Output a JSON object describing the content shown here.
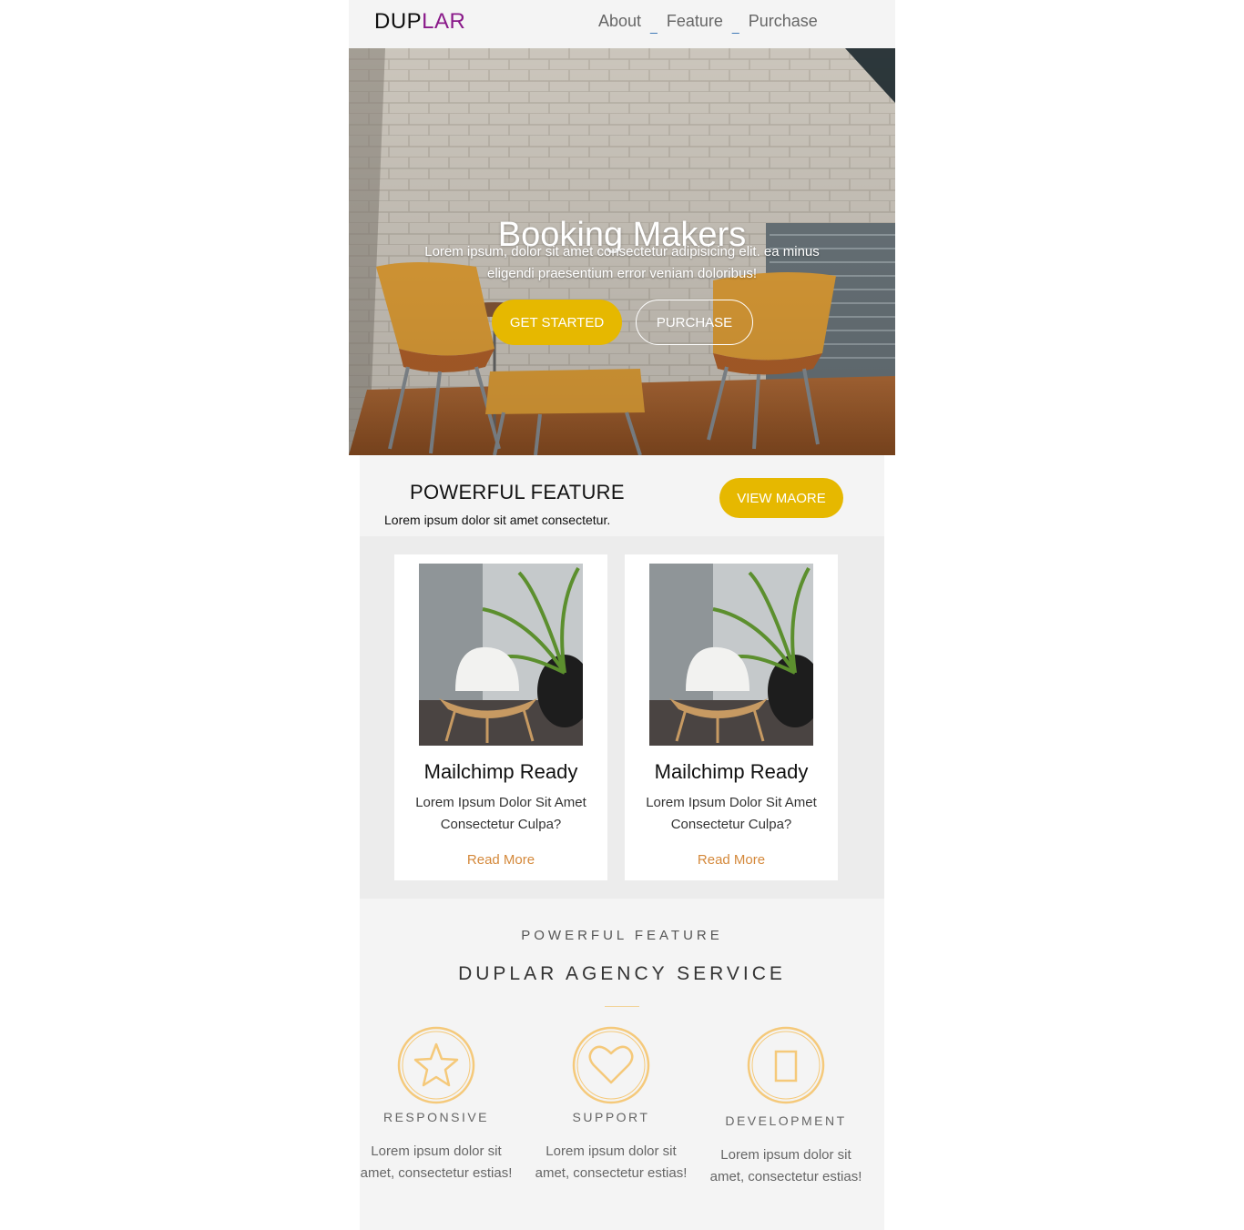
{
  "header": {
    "logo_part1": "DUP",
    "logo_part2": "LAR",
    "nav": [
      "About",
      "Feature",
      "Purchase"
    ]
  },
  "hero": {
    "title": "Booking Makers",
    "text": "Lorem ipsum, dolor sit amet consectetur adipisicing elit. ea minus eligendi praesentium error veniam doloribus!",
    "primary_button": "GET STARTED",
    "secondary_button": "PURCHASE"
  },
  "feature": {
    "heading": "POWERFUL FEATURE",
    "subtext": "Lorem ipsum dolor sit amet consectetur.",
    "button": "VIEW MAORE"
  },
  "cards": [
    {
      "title": "Mailchimp Ready",
      "text": "Lorem Ipsum Dolor Sit Amet Consectetur Culpa?",
      "link": "Read More"
    },
    {
      "title": "Mailchimp Ready",
      "text": "Lorem Ipsum Dolor Sit Amet Consectetur Culpa?",
      "link": "Read More"
    }
  ],
  "services": {
    "kicker": "POWERFUL FEATURE",
    "heading": "DUPLAR AGENCY SERVICE",
    "items": [
      {
        "icon": "star-icon",
        "label": "RESPONSIVE",
        "text": "Lorem ipsum dolor sit amet, consectetur estias!"
      },
      {
        "icon": "heart-icon",
        "label": "SUPPORT",
        "text": "Lorem ipsum dolor sit amet, consectetur estias!"
      },
      {
        "icon": "tablet-icon",
        "label": "DEVELOPMENT",
        "text": "Lorem ipsum dolor sit amet, consectetur estias!"
      }
    ]
  },
  "colors": {
    "accent": "#e6b800",
    "logo_accent": "#8a1a8a",
    "link": "#d4883a",
    "icon": "#f5c97a"
  }
}
